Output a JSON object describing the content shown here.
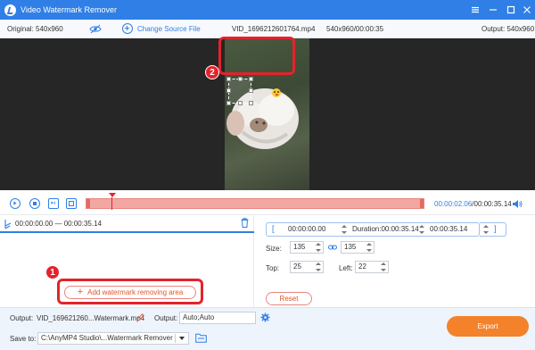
{
  "titlebar": {
    "title": "Video Watermark Remover"
  },
  "topbar": {
    "original": "Original: 540x960",
    "change_source": "Change Source File",
    "filename": "VID_1696212601764.mp4",
    "resolution_duration": "540x960/00:00:35",
    "output": "Output: 540x960"
  },
  "callouts": {
    "one": "1",
    "two": "2"
  },
  "timeline": {
    "current": "00:00:02.06",
    "total": "/00:00:35.14"
  },
  "segment": {
    "range": "00:00:00.00 — 00:00:35.14"
  },
  "left": {
    "add_area": "Add watermark removing area"
  },
  "trim": {
    "start": "00:00:00.00",
    "duration": "Duration:00:00:35.14",
    "end": "00:00:35.14"
  },
  "size": {
    "label": "Size:",
    "width": "135",
    "height": "135"
  },
  "position": {
    "top_label": "Top:",
    "top": "25",
    "left_label": "Left:",
    "left": "22"
  },
  "reset_label": "Reset",
  "bottom": {
    "output_label": "Output:",
    "output_file": "VID_169621260...Watermark.mp4",
    "output_label2": "Output:",
    "output_setting": "Auto;Auto",
    "save_label": "Save to:",
    "save_path": "C:\\AnyMP4 Studio\\...Watermark Remover",
    "export": "Export"
  },
  "colors": {
    "accent": "#2f7fe6",
    "export": "#f4822a",
    "callout": "#e3232c"
  }
}
